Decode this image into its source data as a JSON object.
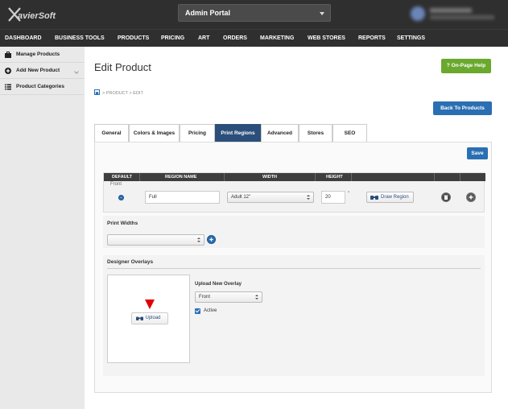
{
  "header": {
    "logo": "XavierSoft",
    "portal": "Admin Portal"
  },
  "nav": {
    "items": [
      "DASHBOARD",
      "BUSINESS TOOLS",
      "PRODUCTS",
      "PRICING",
      "ART",
      "ORDERS",
      "MARKETING",
      "WEB STORES",
      "REPORTS",
      "SETTINGS"
    ]
  },
  "sidebar": {
    "items": [
      {
        "label": "Manage Products",
        "icon": "briefcase-icon"
      },
      {
        "label": "Add New Product",
        "icon": "plus-circle-icon"
      },
      {
        "label": "Product Categories",
        "icon": "list-icon"
      }
    ]
  },
  "page": {
    "title": "Edit Product",
    "help": "? On-Page Help",
    "breadcrumb": [
      "PRODUCT",
      "EDIT"
    ],
    "back": "Back To Products",
    "save": "Save"
  },
  "tabs": [
    {
      "label": "General"
    },
    {
      "label": "Colors & Images"
    },
    {
      "label": "Pricing"
    },
    {
      "label": "Print Regions",
      "active": true
    },
    {
      "label": "Advanced"
    },
    {
      "label": "Stores"
    },
    {
      "label": "SEO"
    }
  ],
  "regions": {
    "columns": [
      "DEFAULT",
      "REGION NAME",
      "WIDTH",
      "HEIGHT"
    ],
    "group": "Front",
    "row": {
      "name": "Full",
      "width": "Adult 12\"",
      "height": "20",
      "unit": "\"",
      "draw": "Draw Region"
    }
  },
  "print_widths": {
    "title": "Print Widths",
    "selected": ""
  },
  "overlays": {
    "title": "Designer Overlays",
    "upload": "Upload",
    "upload_new": "Upload New Overlay",
    "region": "Front",
    "active": "Active"
  },
  "colors": {
    "accent": "#2b6fb3",
    "active_tab": "#2b4f7a",
    "help": "#6aa92d",
    "marker": "#e00000"
  }
}
